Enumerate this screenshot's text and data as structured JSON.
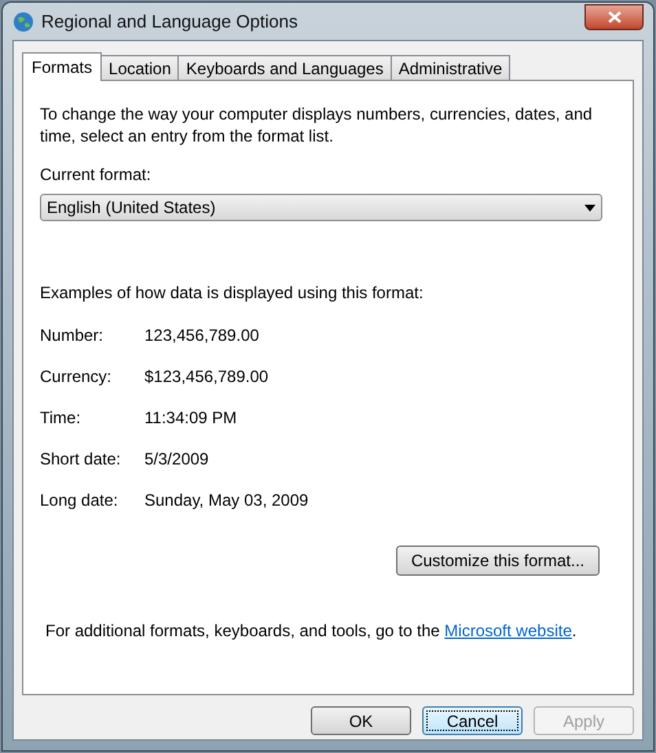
{
  "window": {
    "title": "Regional and Language Options"
  },
  "tabs": [
    {
      "label": "Formats",
      "selected": true
    },
    {
      "label": "Location",
      "selected": false
    },
    {
      "label": "Keyboards and Languages",
      "selected": false
    },
    {
      "label": "Administrative",
      "selected": false
    }
  ],
  "intro": "To change the way your computer displays numbers, currencies, dates, and time, select an entry from the format list.",
  "current_format": {
    "label": "Current format:",
    "value": "English (United States)"
  },
  "examples_heading": "Examples of how data is displayed using this format:",
  "examples": [
    {
      "label": "Number:",
      "value": "123,456,789.00"
    },
    {
      "label": "Currency:",
      "value": "$123,456,789.00"
    },
    {
      "label": "Time:",
      "value": "11:34:09 PM"
    },
    {
      "label": "Short date:",
      "value": "5/3/2009"
    },
    {
      "label": "Long date:",
      "value": "Sunday, May 03, 2009"
    }
  ],
  "customize_button": "Customize this format...",
  "footer": {
    "text": "For additional formats, keyboards, and tools, go to the ",
    "link": "Microsoft website",
    "after": "."
  },
  "buttons": [
    {
      "label": "OK",
      "focused": false,
      "disabled": false
    },
    {
      "label": "Cancel",
      "focused": true,
      "disabled": false
    },
    {
      "label": "Apply",
      "focused": false,
      "disabled": true
    }
  ]
}
